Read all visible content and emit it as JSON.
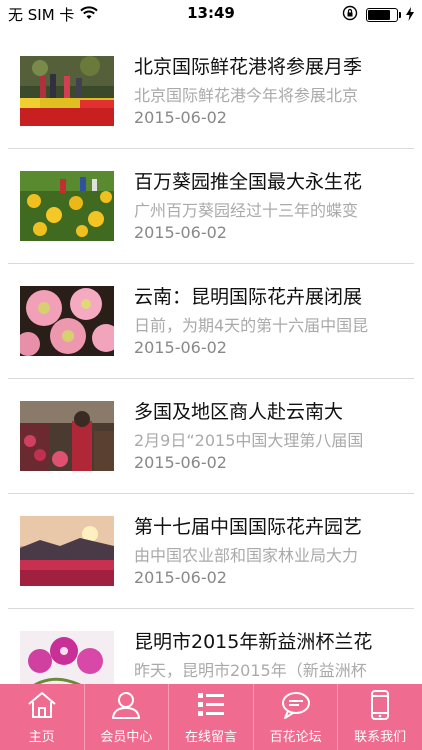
{
  "status_bar": {
    "carrier": "无 SIM 卡",
    "time": "13:49",
    "battery_level": 0.85
  },
  "news": [
    {
      "title": "北京国际鲜花港将参展月季",
      "summary": "北京国际鲜花港今年将参展北京",
      "date": "2015-06-02",
      "thumb": "tulips-icon"
    },
    {
      "title": "百万葵园推全国最大永生花",
      "summary": "广州百万葵园经过十三年的蝶变",
      "date": "2015-06-02",
      "thumb": "sunflowers-icon"
    },
    {
      "title": "云南：昆明国际花卉展闭展",
      "summary": "日前，为期4天的第十六届中国昆",
      "date": "2015-06-02",
      "thumb": "gerbera-icon"
    },
    {
      "title": "多国及地区商人赴云南大",
      "summary": "2月9日“2015中国大理第八届国",
      "date": "2015-06-02",
      "thumb": "market-icon"
    },
    {
      "title": "第十七届中国国际花卉园艺",
      "summary": "由中国农业部和国家林业局大力",
      "date": "2015-06-02",
      "thumb": "landscape-icon"
    },
    {
      "title": "昆明市2015年新益洲杯兰花",
      "summary": "昨天，昆明市2015年（新益洲杯",
      "date": "",
      "thumb": "orchid-icon"
    }
  ],
  "tabs": [
    {
      "label": "主页",
      "icon": "home-icon"
    },
    {
      "label": "会员中心",
      "icon": "user-icon"
    },
    {
      "label": "在线留言",
      "icon": "list-icon"
    },
    {
      "label": "百花论坛",
      "icon": "chat-icon"
    },
    {
      "label": "联系我们",
      "icon": "phone-icon"
    }
  ],
  "colors": {
    "tab_bar": "#f06b90",
    "title": "#111111",
    "summary": "#aaaaaa",
    "date": "#888888"
  }
}
